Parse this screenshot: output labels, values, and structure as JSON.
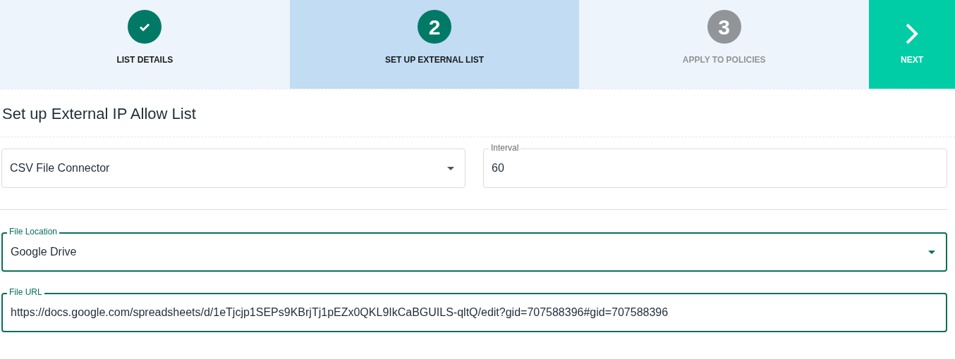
{
  "steps": [
    {
      "label": "LIST DETAILS",
      "completed": true,
      "disabled": false,
      "selected": false
    },
    {
      "number": "2",
      "label": "SET UP EXTERNAL LIST",
      "completed": false,
      "disabled": false,
      "selected": true
    },
    {
      "number": "3",
      "label": "APPLY TO POLICIES",
      "completed": false,
      "disabled": true,
      "selected": false
    }
  ],
  "next_button": {
    "label": "NEXT"
  },
  "title": "Set up External IP Allow List",
  "row_1": [
    {
      "kind": "select",
      "value": "CSV File Connector",
      "focused": false
    },
    {
      "kind": "text",
      "label": "Interval",
      "value": "60",
      "focused": false
    }
  ],
  "row_2": [
    {
      "kind": "select",
      "label": "File Location",
      "value": "Google Drive",
      "focused": true
    },
    {
      "kind": "text",
      "label": "File URL",
      "value": "https://docs.google.com/spreadsheets/d/1eTjcjp1SEPs9KBrjTj1pEZx0QKL9IkCaBGUILS-qltQ/edit?gid=707588396#gid=707588396",
      "focused": true
    }
  ]
}
